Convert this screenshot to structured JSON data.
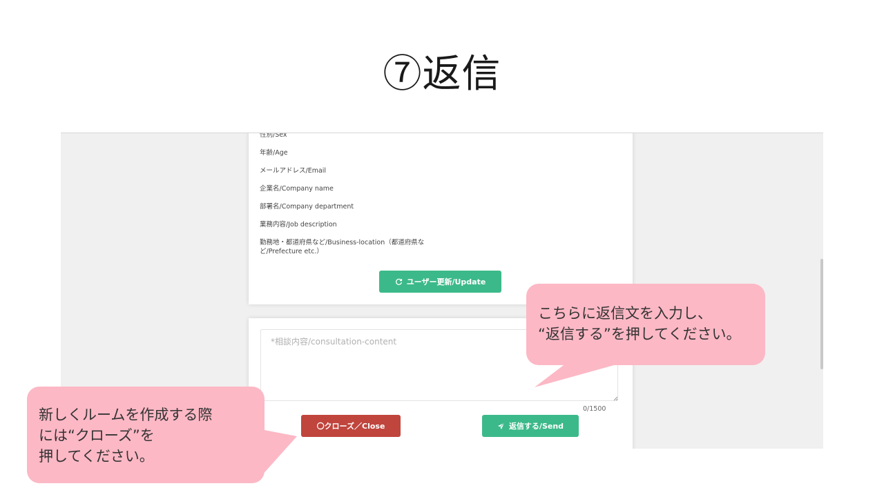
{
  "slide": {
    "title": "⑦返信"
  },
  "user_card": {
    "fields": [
      "性別/Sex",
      "年齢/Age",
      "メールアドレス/Email",
      "企業名/Company name",
      "部署名/Company department",
      "業務内容/Job description",
      "勤務地・都道府県など/Business-location（都道府県など/Prefecture etc.）"
    ],
    "update_button": "ユーザー更新/Update"
  },
  "reply_card": {
    "textarea_value": "",
    "textarea_placeholder": "*相談内容/consultation-content",
    "counter": "0/1500",
    "close_button": "〇クローズ／Close",
    "send_button": "返信する/Send"
  },
  "callouts": {
    "right": [
      "こちらに返信文を入力し、",
      "“返信する”を押してください。"
    ],
    "left": [
      "新しくルームを作成する際",
      "には“クローズ”を",
      "押してください。"
    ]
  },
  "colors": {
    "green": "#3cb98a",
    "red": "#c0453d",
    "callout": "#fcb8c5",
    "panel_bg": "#f0f0f0"
  },
  "icons": {
    "update": "refresh-icon",
    "send": "paper-plane-icon"
  }
}
